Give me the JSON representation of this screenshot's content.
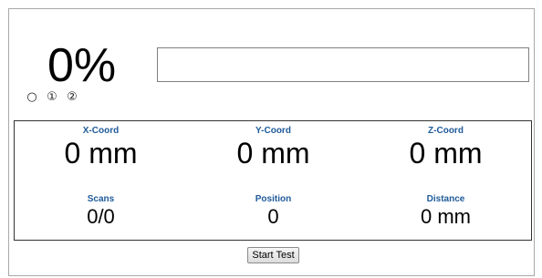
{
  "progress": {
    "percent_text": "0%",
    "value": 0
  },
  "steps": [
    "○",
    "①",
    "②"
  ],
  "readings": {
    "x": {
      "label": "X-Coord",
      "value": "0 mm"
    },
    "y": {
      "label": "Y-Coord",
      "value": "0 mm"
    },
    "z": {
      "label": "Z-Coord",
      "value": "0 mm"
    },
    "scans": {
      "label": "Scans",
      "value": "0/0"
    },
    "position": {
      "label": "Position",
      "value": "0"
    },
    "distance": {
      "label": "Distance",
      "value": "0 mm"
    }
  },
  "actions": {
    "start_label": "Start Test"
  },
  "colors": {
    "label": "#1f5a99",
    "progress_fill": "#3c78d8"
  }
}
